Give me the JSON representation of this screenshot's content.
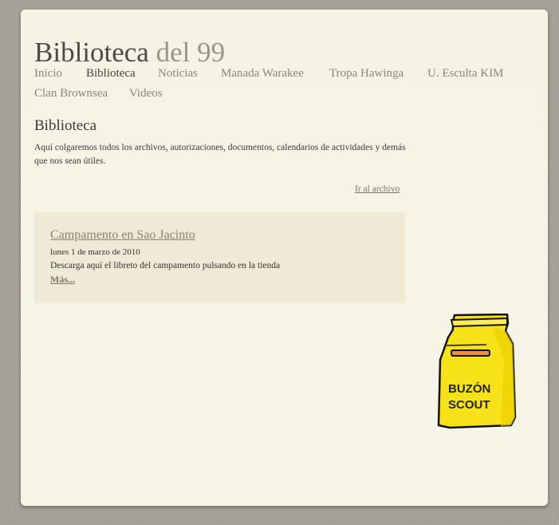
{
  "site": {
    "title_main": "Biblioteca",
    "title_sub": "del 99"
  },
  "nav": {
    "items": [
      {
        "label": "Inicio"
      },
      {
        "label": "Biblioteca"
      },
      {
        "label": "Noticias"
      },
      {
        "label": "Manada Warakee"
      },
      {
        "label": "Tropa Hawinga"
      },
      {
        "label": "U. Esculta KIM"
      },
      {
        "label": "Clan Brownsea"
      },
      {
        "label": "Videos"
      }
    ],
    "active": "Biblioteca"
  },
  "section": {
    "title": "Biblioteca",
    "intro": "Aquí colgaremos todos los archivos, autorizaciones, documentos, calendarios de actividades y demás que nos sean útiles."
  },
  "archive_link": "Ir al archivo",
  "post": {
    "title": "Campamento en Sao Jacinto",
    "date": "lunes 1 de marzo de 2010",
    "description": "Descarga aquí el libreto del campamento pulsando en la tienda",
    "more": "Más..."
  },
  "mailbox": {
    "line1": "BUZÓN",
    "line2": "SCOUT",
    "icon": "mailbox-icon",
    "color": "#f7e21a"
  },
  "colors": {
    "page_background": "#f6f4e6",
    "post_background": "#efe9d6",
    "link": "#8a8270"
  }
}
